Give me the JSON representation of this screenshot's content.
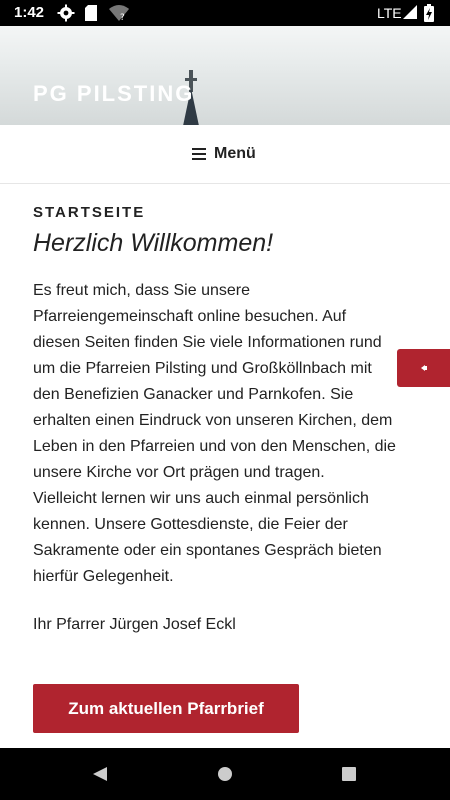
{
  "status_bar": {
    "time": "1:42",
    "network": "LTE"
  },
  "site": {
    "title": "PG PILSTING"
  },
  "nav": {
    "menu_label": "Menü",
    "menu_icon": "hamburger-icon"
  },
  "page": {
    "kicker": "STARTSEITE",
    "headline": "Herzlich Willkommen!",
    "lines": [
      "Es freut mich, dass Sie unsere",
      "Pfarreiengemeinschaft online besuchen. Auf",
      "diesen Seiten finden Sie viele Informationen rund",
      "um die Pfarreien Pilsting und Großköllnbach mit",
      "den Benefizien Ganacker und Parnkofen. Sie",
      "erhalten einen Eindruck von unseren Kirchen, dem",
      "Leben in den Pfarreien und von den Menschen, die",
      "unsere Kirche vor Ort prägen und tragen.",
      "Vielleicht lernen wir uns auch einmal persönlich",
      "kennen. Unsere Gottesdienste, die Feier der",
      "Sakramente oder ein spontanes Gespräch bieten",
      "hierfür Gelegenheit."
    ],
    "signature": "Ihr Pfarrer Jürgen Josef Eckl",
    "cta_label": "Zum aktuellen Pfarrbrief"
  },
  "side_tab": {
    "icon": "speaker-icon"
  },
  "colors": {
    "accent": "#b0242f",
    "status_bar": "#000000",
    "text": "#222222"
  }
}
